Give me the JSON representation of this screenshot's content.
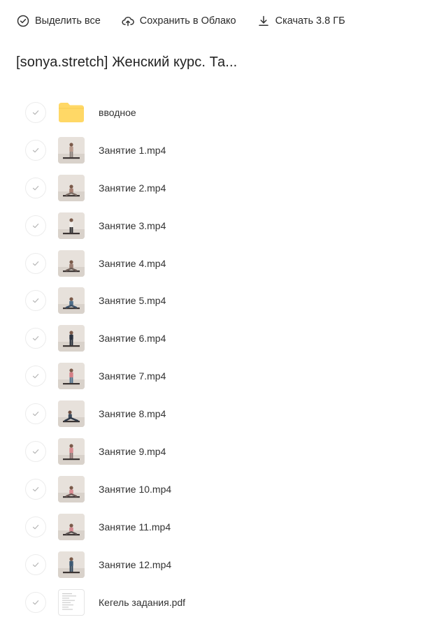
{
  "toolbar": {
    "select_all": "Выделить все",
    "save_cloud": "Сохранить в Облако",
    "download": "Скачать 3.8 ГБ"
  },
  "page_title": "[sonya.stretch] Женский курс. Та...",
  "files": [
    {
      "name": "вводное",
      "kind": "folder",
      "icon": "folder-icon"
    },
    {
      "name": "Занятие 1.mp4",
      "kind": "video",
      "icon": "video-thumbnail",
      "pose": "stand",
      "shirt": "#b99a8c",
      "pants": "#8a7f7a"
    },
    {
      "name": "Занятие 2.mp4",
      "kind": "video",
      "icon": "video-thumbnail",
      "pose": "sit",
      "shirt": "#a67f71",
      "pants": "#7e6f68"
    },
    {
      "name": "Занятие 3.mp4",
      "kind": "video",
      "icon": "video-thumbnail",
      "pose": "stand",
      "shirt": "#f2efec",
      "pants": "#2b2b2d"
    },
    {
      "name": "Занятие 4.mp4",
      "kind": "video",
      "icon": "video-thumbnail",
      "pose": "sit",
      "shirt": "#9c7e72",
      "pants": "#6e5f58"
    },
    {
      "name": "Занятие 5.mp4",
      "kind": "video",
      "icon": "video-thumbnail",
      "pose": "sit",
      "shirt": "#4f6e8a",
      "pants": "#3a4f66"
    },
    {
      "name": "Занятие 6.mp4",
      "kind": "video",
      "icon": "video-thumbnail",
      "pose": "stand",
      "shirt": "#2b3340",
      "pants": "#1f2633"
    },
    {
      "name": "Занятие 7.mp4",
      "kind": "video",
      "icon": "video-thumbnail",
      "pose": "stand",
      "shirt": "#d57f86",
      "pants": "#4e6d87"
    },
    {
      "name": "Занятие 8.mp4",
      "kind": "video",
      "icon": "video-thumbnail",
      "pose": "split",
      "shirt": "#3d4b5c",
      "pants": "#2f3947"
    },
    {
      "name": "Занятие 9.mp4",
      "kind": "video",
      "icon": "video-thumbnail",
      "pose": "stand",
      "shirt": "#d88a8f",
      "pants": "#8b6f6e"
    },
    {
      "name": "Занятие 10.mp4",
      "kind": "video",
      "icon": "video-thumbnail",
      "pose": "sit",
      "shirt": "#d98c92",
      "pants": "#6e5a57"
    },
    {
      "name": "Занятие 11.mp4",
      "kind": "video",
      "icon": "video-thumbnail",
      "pose": "sit",
      "shirt": "#d48890",
      "pants": "#5d5554"
    },
    {
      "name": "Занятие 12.mp4",
      "kind": "video",
      "icon": "video-thumbnail",
      "pose": "stand",
      "shirt": "#3e5a74",
      "pants": "#2d4257"
    },
    {
      "name": "Кегель задания.pdf",
      "kind": "pdf",
      "icon": "pdf-thumbnail"
    }
  ],
  "colors": {
    "folder": "#ffd866",
    "check_border": "#ececec",
    "check_mark": "#b5b5b5",
    "text": "#333333"
  }
}
